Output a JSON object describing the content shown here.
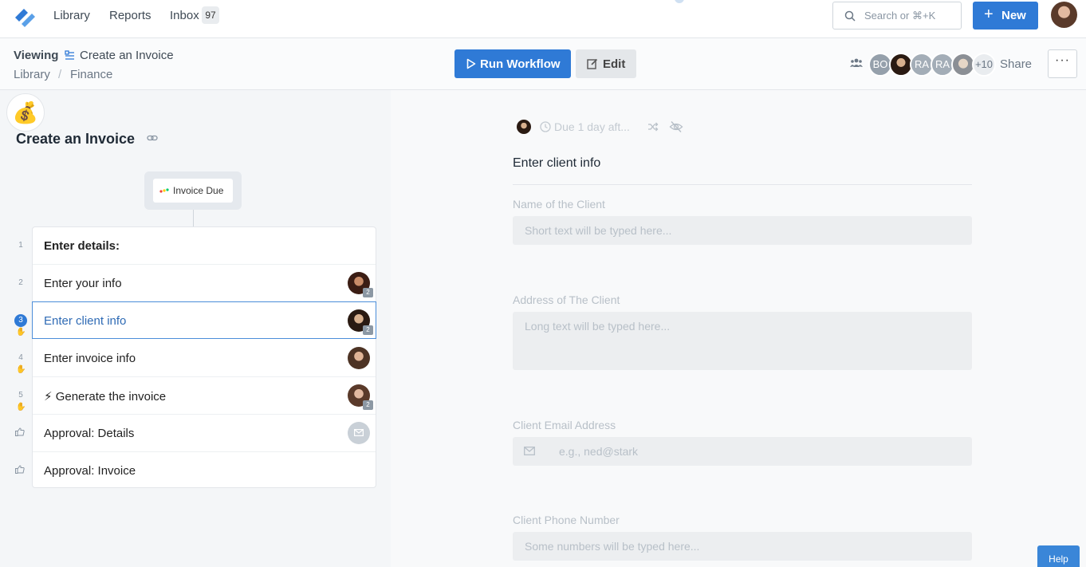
{
  "topnav": {
    "nav": [
      {
        "label": "Library"
      },
      {
        "label": "Reports"
      },
      {
        "label": "Inbox"
      }
    ],
    "inbox_count": "97",
    "search_placeholder": "Search or ⌘+K",
    "new_label": "New"
  },
  "header": {
    "viewing_label": "Viewing",
    "workflow_title": "Create an Invoice",
    "breadcrumb": [
      "Library",
      "/",
      "Finance"
    ],
    "run_label": "Run Workflow",
    "edit_label": "Edit",
    "avatars": [
      "BO",
      "RA",
      "RA"
    ],
    "more_count": "+10",
    "share_label": "Share",
    "kebab": "···"
  },
  "left": {
    "emoji": "💰",
    "title": "Create an Invoice",
    "trigger": "Invoice Due",
    "steps": [
      {
        "num": "1",
        "label": "Enter details:"
      },
      {
        "num": "2",
        "label": "Enter your info",
        "badge": "2"
      },
      {
        "num": "3",
        "label": "Enter client info",
        "badge": "2"
      },
      {
        "num": "4",
        "label": "Enter invoice info"
      },
      {
        "num": "5",
        "label": "⚡ Generate the invoice",
        "badge": "2"
      },
      {
        "label": "Approval: Details"
      },
      {
        "label": "Approval: Invoice"
      }
    ]
  },
  "right": {
    "due_text": "Due 1 day aft...",
    "task_title": "Enter client info",
    "fields": [
      {
        "label": "Name of the Client",
        "placeholder": "Short text will be typed here..."
      },
      {
        "label": "Address of The Client",
        "placeholder": "Long text will be typed here..."
      },
      {
        "label": "Client Email Address",
        "placeholder": "e.g., ned@stark"
      },
      {
        "label": "Client Phone Number",
        "placeholder": "Some numbers will be typed here..."
      }
    ]
  },
  "help_label": "Help",
  "colors": {
    "accent": "#2f7ad6",
    "active_border": "#4c8ed9"
  }
}
